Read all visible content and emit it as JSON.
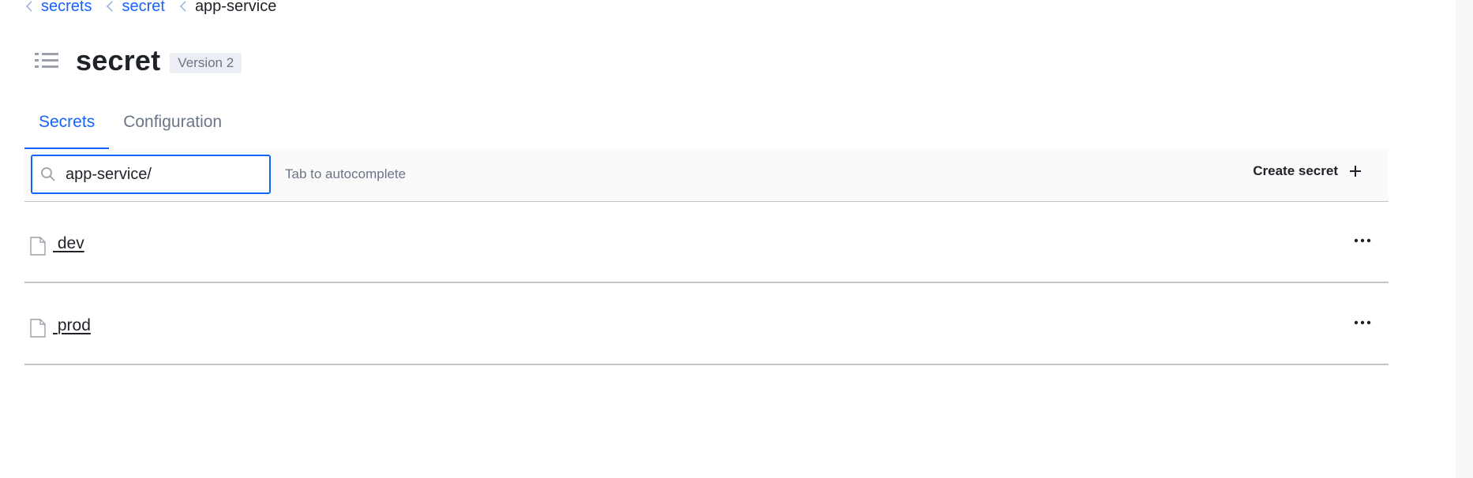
{
  "breadcrumb": [
    {
      "label": "secrets",
      "current": false
    },
    {
      "label": "secret",
      "current": false
    },
    {
      "label": "app-service",
      "current": true
    }
  ],
  "header": {
    "title": "secret",
    "version_badge": "Version 2"
  },
  "tabs": [
    {
      "label": "Secrets",
      "active": true
    },
    {
      "label": "Configuration",
      "active": false
    }
  ],
  "toolbar": {
    "search_value": "app-service/",
    "hint": "Tab to autocomplete",
    "create_label": "Create secret"
  },
  "secrets": [
    {
      "name": "dev"
    },
    {
      "name": "prod"
    }
  ],
  "colors": {
    "accent": "#1563ff",
    "text": "#1f2329",
    "muted": "#6a7585",
    "divider": "#c2c5cb"
  }
}
